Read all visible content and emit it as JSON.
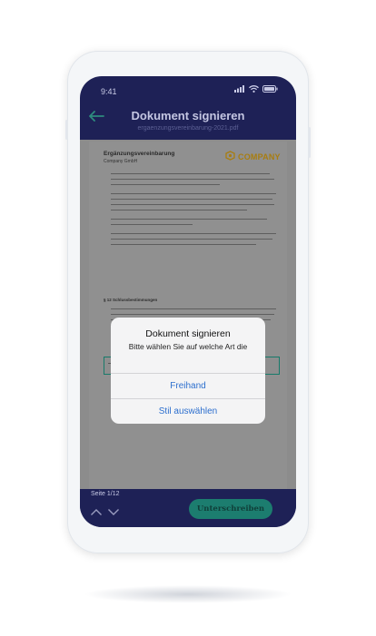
{
  "status_bar": {
    "time": "9:41"
  },
  "header": {
    "title": "Dokument signieren",
    "subtitle": "ergaenzungsvereinbarung-2021.pdf",
    "back_icon": "arrow-left-icon"
  },
  "document": {
    "title": "Ergänzungsvereinbarung",
    "company_name": "Company GmbH",
    "logo_text": "COMPANY",
    "section_heading": "§ 12 Schlussbestimmungen"
  },
  "dialog": {
    "title": "Dokument signieren",
    "message": "Bitte wählen Sie auf welche Art die",
    "actions": [
      "Freihand",
      "Stil auswählen"
    ]
  },
  "footer": {
    "page_indicator": "Seite 1/12",
    "sign_button": "Unterschreiben"
  },
  "colors": {
    "navy": "#1e2156",
    "accent_teal": "#1c7d6f",
    "link_blue": "#2d6fce",
    "logo_gold": "#a87d10"
  }
}
